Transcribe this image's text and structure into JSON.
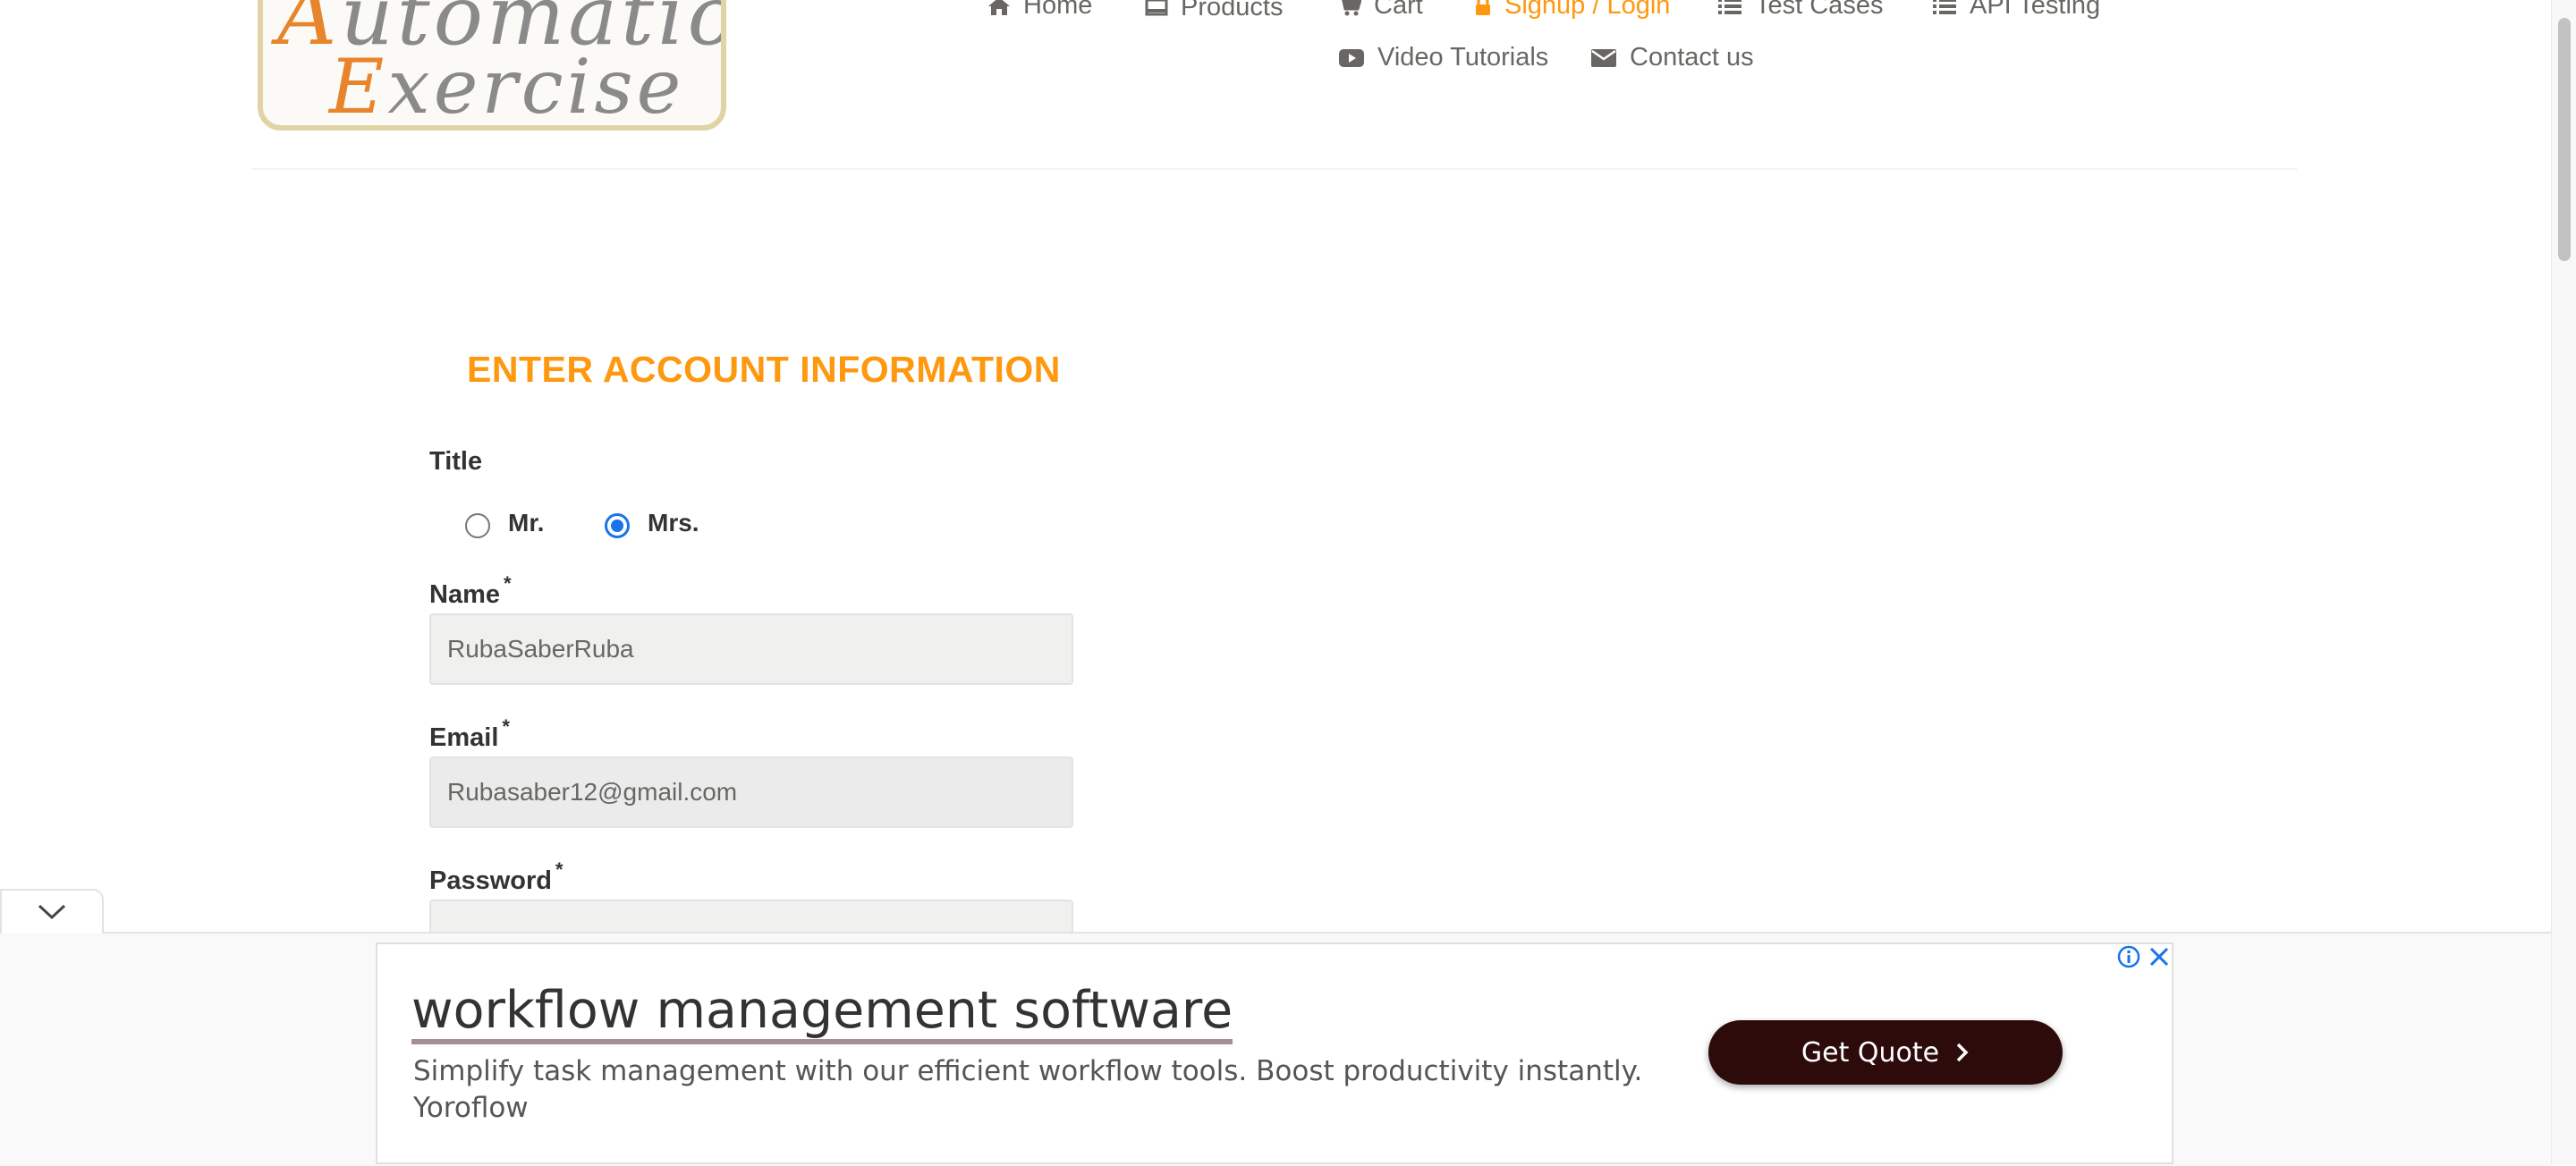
{
  "logo": {
    "line1": "Automation",
    "line2": "Exercise"
  },
  "nav": {
    "home": "Home",
    "products": "Products",
    "cart": "Cart",
    "signup_login": "Signup / Login",
    "test_cases": "Test Cases",
    "api_testing": "API Testing",
    "video_tutorials": "Video Tutorials",
    "contact_us": "Contact us"
  },
  "form": {
    "title": "ENTER ACCOUNT INFORMATION",
    "title_label": "Title",
    "radio_mr": "Mr.",
    "radio_mrs": "Mrs.",
    "selected_title": "Mrs.",
    "name_label": "Name",
    "name_value": "RubaSaberRuba",
    "email_label": "Email",
    "email_value": "Rubasaber12@gmail.com",
    "password_label": "Password",
    "password_value": "•••••••••",
    "required_mark": "*"
  },
  "ad": {
    "headline": "workflow management software",
    "description": "Simplify task management with our efficient workflow tools. Boost productivity instantly.",
    "advertiser": "Yoroflow",
    "cta": "Get Quote"
  },
  "colors": {
    "accent": "#fe980f",
    "radio_checked": "#1a73e8",
    "ad_button": "#2d0b0b"
  }
}
